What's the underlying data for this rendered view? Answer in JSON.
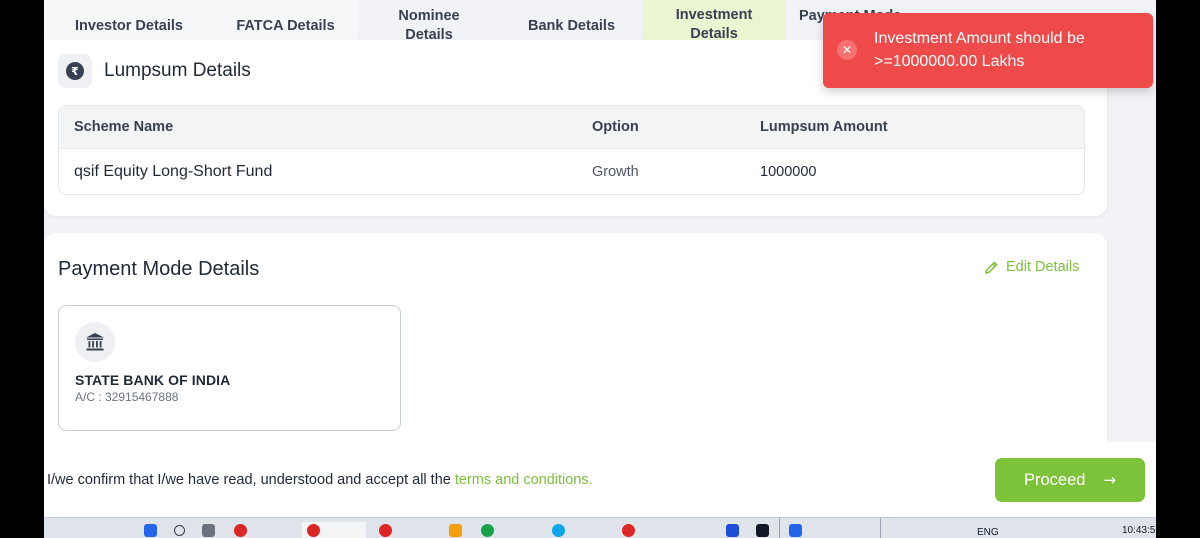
{
  "tabs": [
    {
      "label": "Investor Details"
    },
    {
      "label": "FATCA Details"
    },
    {
      "label": "Nominee Details"
    },
    {
      "label": "Bank Details"
    },
    {
      "label": "Investment Details"
    },
    {
      "label": "Payment Mode"
    }
  ],
  "lumpsum": {
    "title": "Lumpsum Details",
    "icon": "rupee-icon",
    "columns": [
      "Scheme Name",
      "Option",
      "Lumpsum Amount"
    ],
    "rows": [
      {
        "scheme": "qsif Equity Long-Short Fund",
        "option": "Growth",
        "amount": "1000000"
      }
    ]
  },
  "payment": {
    "title": "Payment Mode Details",
    "edit_label": "Edit Details",
    "bank_name": "STATE BANK OF INDIA",
    "account": "A/C : 32915467888"
  },
  "footer": {
    "confirm_text": "I/we confirm that I/we have read, understood and accept all the ",
    "terms_link": "terms and conditions.",
    "proceed_label": "Proceed"
  },
  "toast": {
    "message": "Investment Amount should be >=1000000.00 Lakhs"
  },
  "taskbar": {
    "lang": "ENG",
    "time": "10:43:5"
  },
  "colors": {
    "accent": "#7cc23a",
    "error": "#ee4a4a",
    "active_tab_bg": "#eaf6d2"
  }
}
